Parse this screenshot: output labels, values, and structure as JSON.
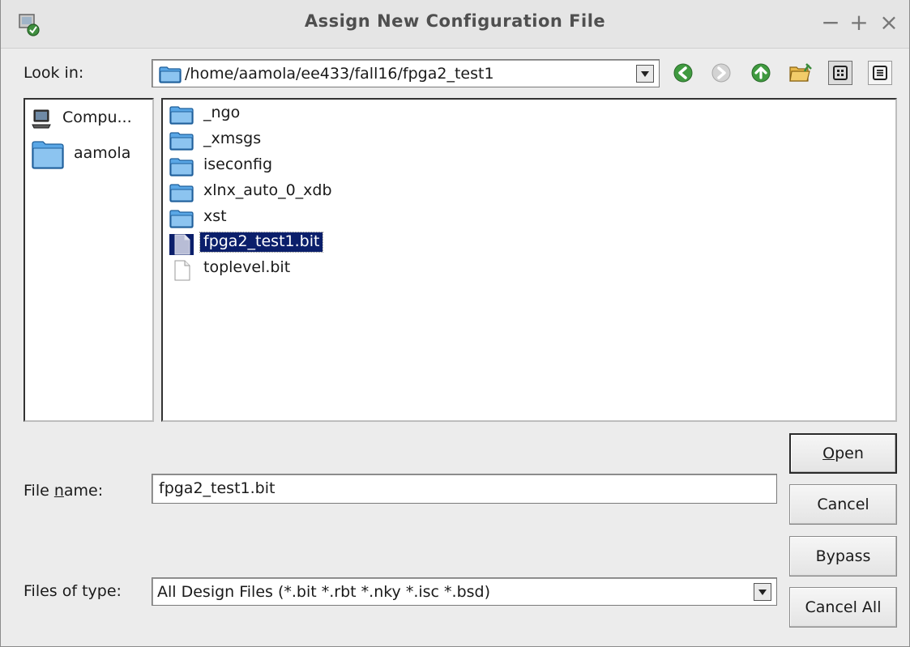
{
  "window": {
    "title": "Assign New Configuration File",
    "controls": {
      "minimize": "−",
      "maximize": "+",
      "close": "×"
    }
  },
  "look_in": {
    "label": "Look in:",
    "path": "/home/aamola/ee433/fall16/fpga2_test1"
  },
  "toolbar": {
    "icons": [
      "back-icon",
      "forward-icon",
      "up-folder-icon",
      "new-folder-icon",
      "list-view-icon",
      "details-view-icon"
    ]
  },
  "places": {
    "items": [
      {
        "label": "Compu...",
        "icon": "computer-icon"
      },
      {
        "label": "aamola",
        "icon": "folder-icon"
      }
    ]
  },
  "files": {
    "items": [
      {
        "name": "_ngo",
        "type": "folder"
      },
      {
        "name": "_xmsgs",
        "type": "folder"
      },
      {
        "name": "iseconfig",
        "type": "folder"
      },
      {
        "name": "xlnx_auto_0_xdb",
        "type": "folder"
      },
      {
        "name": "xst",
        "type": "folder"
      },
      {
        "name": "fpga2_test1.bit",
        "type": "file",
        "selected": true
      },
      {
        "name": "toplevel.bit",
        "type": "file"
      }
    ]
  },
  "file_name": {
    "label_pre": "File ",
    "label_mnemonic": "n",
    "label_post": "ame:",
    "value": "fpga2_test1.bit"
  },
  "file_type": {
    "label": "Files of type:",
    "selected": "All Design Files (*.bit *.rbt *.nky *.isc *.bsd)"
  },
  "buttons": {
    "open_mnemonic": "O",
    "open_rest": "pen",
    "cancel": "Cancel",
    "bypass": "Bypass",
    "cancel_all": "Cancel All"
  },
  "colors": {
    "selection": "#0b1f6b",
    "folder": "#5aa7e6",
    "dialog_bg": "#ececec"
  }
}
